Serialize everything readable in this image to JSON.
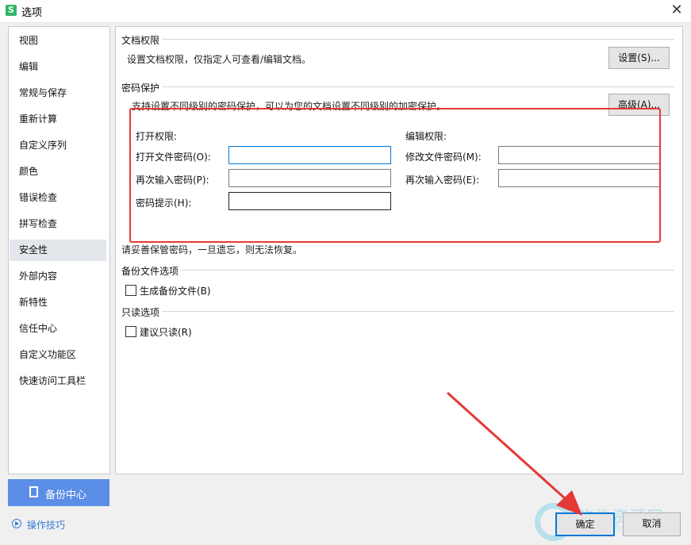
{
  "window": {
    "app_icon_letter": "S",
    "title": "选项",
    "close_glyph": "✕",
    "icons": {
      "app": "wps-spreadsheet-icon",
      "close": "close-icon"
    }
  },
  "nav": {
    "items": [
      {
        "label": "视图"
      },
      {
        "label": "编辑"
      },
      {
        "label": "常规与保存"
      },
      {
        "label": "重新计算"
      },
      {
        "label": "自定义序列"
      },
      {
        "label": "颜色"
      },
      {
        "label": "错误检查"
      },
      {
        "label": "拼写检查"
      },
      {
        "label": "安全性"
      },
      {
        "label": "外部内容"
      },
      {
        "label": "新特性"
      },
      {
        "label": "信任中心"
      },
      {
        "label": "自定义功能区"
      },
      {
        "label": "快速访问工具栏"
      }
    ],
    "selected": "安全性"
  },
  "doc_permissions": {
    "title": "文档权限",
    "desc": "设置文档权限，仅指定人可查看/编辑文档。",
    "settings_button": "设置(S)..."
  },
  "password_protection": {
    "title": "密码保护",
    "desc": "支持设置不同级别的密码保护，可以为您的文档设置不同级别的加密保护。",
    "advanced_button": "高级(A)...",
    "open_permission": {
      "heading": "打开权限:",
      "password_label": "打开文件密码(O):",
      "password_value": "",
      "confirm_label": "再次输入密码(P):",
      "confirm_value": "",
      "hint_label": "密码提示(H):",
      "hint_value": ""
    },
    "edit_permission": {
      "heading": "编辑权限:",
      "password_label": "修改文件密码(M):",
      "password_value": "",
      "confirm_label": "再次输入密码(E):",
      "confirm_value": ""
    },
    "warning": "请妥善保管密码，一旦遗忘，则无法恢复。"
  },
  "backup": {
    "title": "备份文件选项",
    "checkbox_label": "生成备份文件(B)",
    "checked": false
  },
  "readonly": {
    "title": "只读选项",
    "checkbox_label": "建议只读(R)",
    "checked": false
  },
  "footer": {
    "backup_center": "备份中心",
    "tips": "操作技巧",
    "ok": "确定",
    "cancel": "取消"
  },
  "annotation_color": "#e53935",
  "watermark": {
    "text": "软件资源网",
    "url": "www.officezu.com"
  }
}
